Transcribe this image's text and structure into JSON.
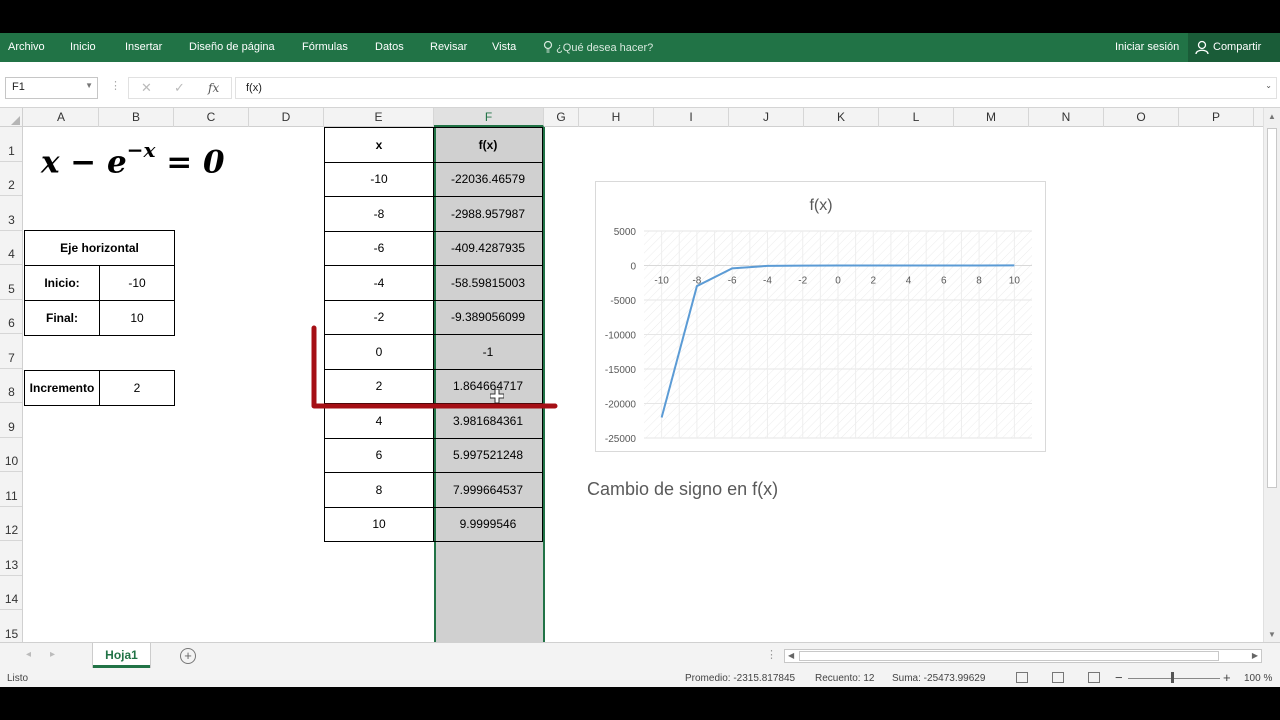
{
  "ribbon": {
    "tabs": [
      "Archivo",
      "Inicio",
      "Insertar",
      "Diseño de página",
      "Fórmulas",
      "Datos",
      "Revisar",
      "Vista"
    ],
    "tell_me": "¿Qué desea hacer?",
    "signin": "Iniciar sesión",
    "share": "Compartir"
  },
  "formula_bar": {
    "name_box": "F1",
    "formula": "f(x)"
  },
  "columns": [
    "A",
    "B",
    "C",
    "D",
    "E",
    "F",
    "G",
    "H",
    "I",
    "J",
    "K",
    "L",
    "M",
    "N",
    "O",
    "P"
  ],
  "selected_column": "F",
  "rows": [
    "1",
    "2",
    "3",
    "4",
    "5",
    "6",
    "7",
    "8",
    "9",
    "10",
    "11",
    "12",
    "13",
    "14",
    "15"
  ],
  "equation": {
    "base": "x − e",
    "exponent": "−x",
    "rhs": " = 0"
  },
  "axis_panel": {
    "header": "Eje horizontal",
    "start_label": "Inicio:",
    "start_value": "-10",
    "end_label": "Final:",
    "end_value": "10",
    "increment_label": "Incremento",
    "increment_value": "2"
  },
  "table": {
    "header_x": "x",
    "header_f": "f(x)",
    "rows": [
      {
        "x": "-10",
        "f": "-22036.46579"
      },
      {
        "x": "-8",
        "f": "-2988.957987"
      },
      {
        "x": "-6",
        "f": "-409.4287935"
      },
      {
        "x": "-4",
        "f": "-58.59815003"
      },
      {
        "x": "-2",
        "f": "-9.389056099"
      },
      {
        "x": "0",
        "f": "-1"
      },
      {
        "x": "2",
        "f": "1.864664717"
      },
      {
        "x": "4",
        "f": "3.981684361"
      },
      {
        "x": "6",
        "f": "5.997521248"
      },
      {
        "x": "8",
        "f": "7.999664537"
      },
      {
        "x": "10",
        "f": "9.9999546"
      }
    ]
  },
  "chart_data": {
    "type": "line",
    "title": "f(x)",
    "x": [
      -10,
      -8,
      -6,
      -4,
      -2,
      0,
      2,
      4,
      6,
      8,
      10
    ],
    "series": [
      {
        "values": [
          -22036.46579,
          -2988.957987,
          -409.4287935,
          -58.59815003,
          -9.389056099,
          -1,
          1.864664717,
          3.981684361,
          5.997521248,
          7.999664537,
          9.9999546
        ]
      }
    ],
    "x_ticks": [
      "-10",
      "-8",
      "-6",
      "-4",
      "-2",
      "0",
      "2",
      "4",
      "6",
      "8",
      "10"
    ],
    "y_ticks": [
      "5000",
      "0",
      "-5000",
      "-10000",
      "-15000",
      "-20000",
      "-25000"
    ],
    "ylim": [
      -25000,
      5000
    ],
    "grid": true,
    "line_color": "#5b9bd5"
  },
  "annotation": "Cambio de signo en f(x)",
  "sheet": {
    "tab": "Hoja1"
  },
  "status": {
    "ready": "Listo",
    "average": "Promedio: -2315.817845",
    "count": "Recuento: 12",
    "sum": "Suma: -25473.99629",
    "zoom": "100 %"
  },
  "colors": {
    "excel_green": "#217346",
    "bracket_red": "#a50f15",
    "selection_gray": "#d0d0d0"
  }
}
